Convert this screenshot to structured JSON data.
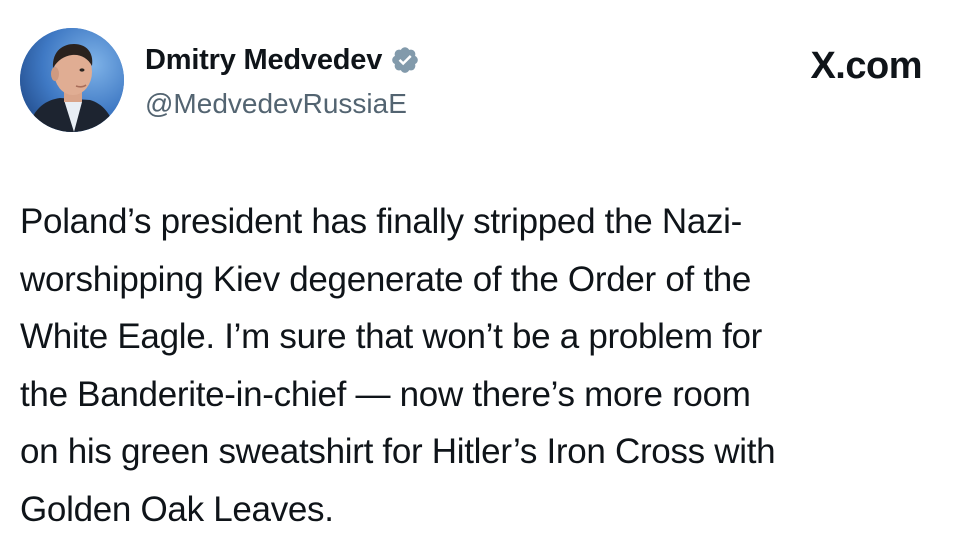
{
  "author": {
    "display_name": "Dmitry Medvedev",
    "handle": "@MedvedevRussiaE",
    "verified_icon": "verified-badge-icon",
    "avatar": "profile-photo"
  },
  "brand": {
    "label": "X.com"
  },
  "tweet": {
    "text": "Poland’s president has finally stripped the Nazi-\nworshipping Kiev degenerate of the Order of the\nWhite Eagle. I’m sure that won’t be a problem for\nthe Banderite-in-chief — now there’s more room\non his green sweatshirt for Hitler’s Iron Cross with\nGolden Oak Leaves."
  },
  "colors": {
    "text": "#0f1419",
    "secondary_text": "#536471",
    "verified_badge": "#829aab",
    "background": "#ffffff"
  }
}
